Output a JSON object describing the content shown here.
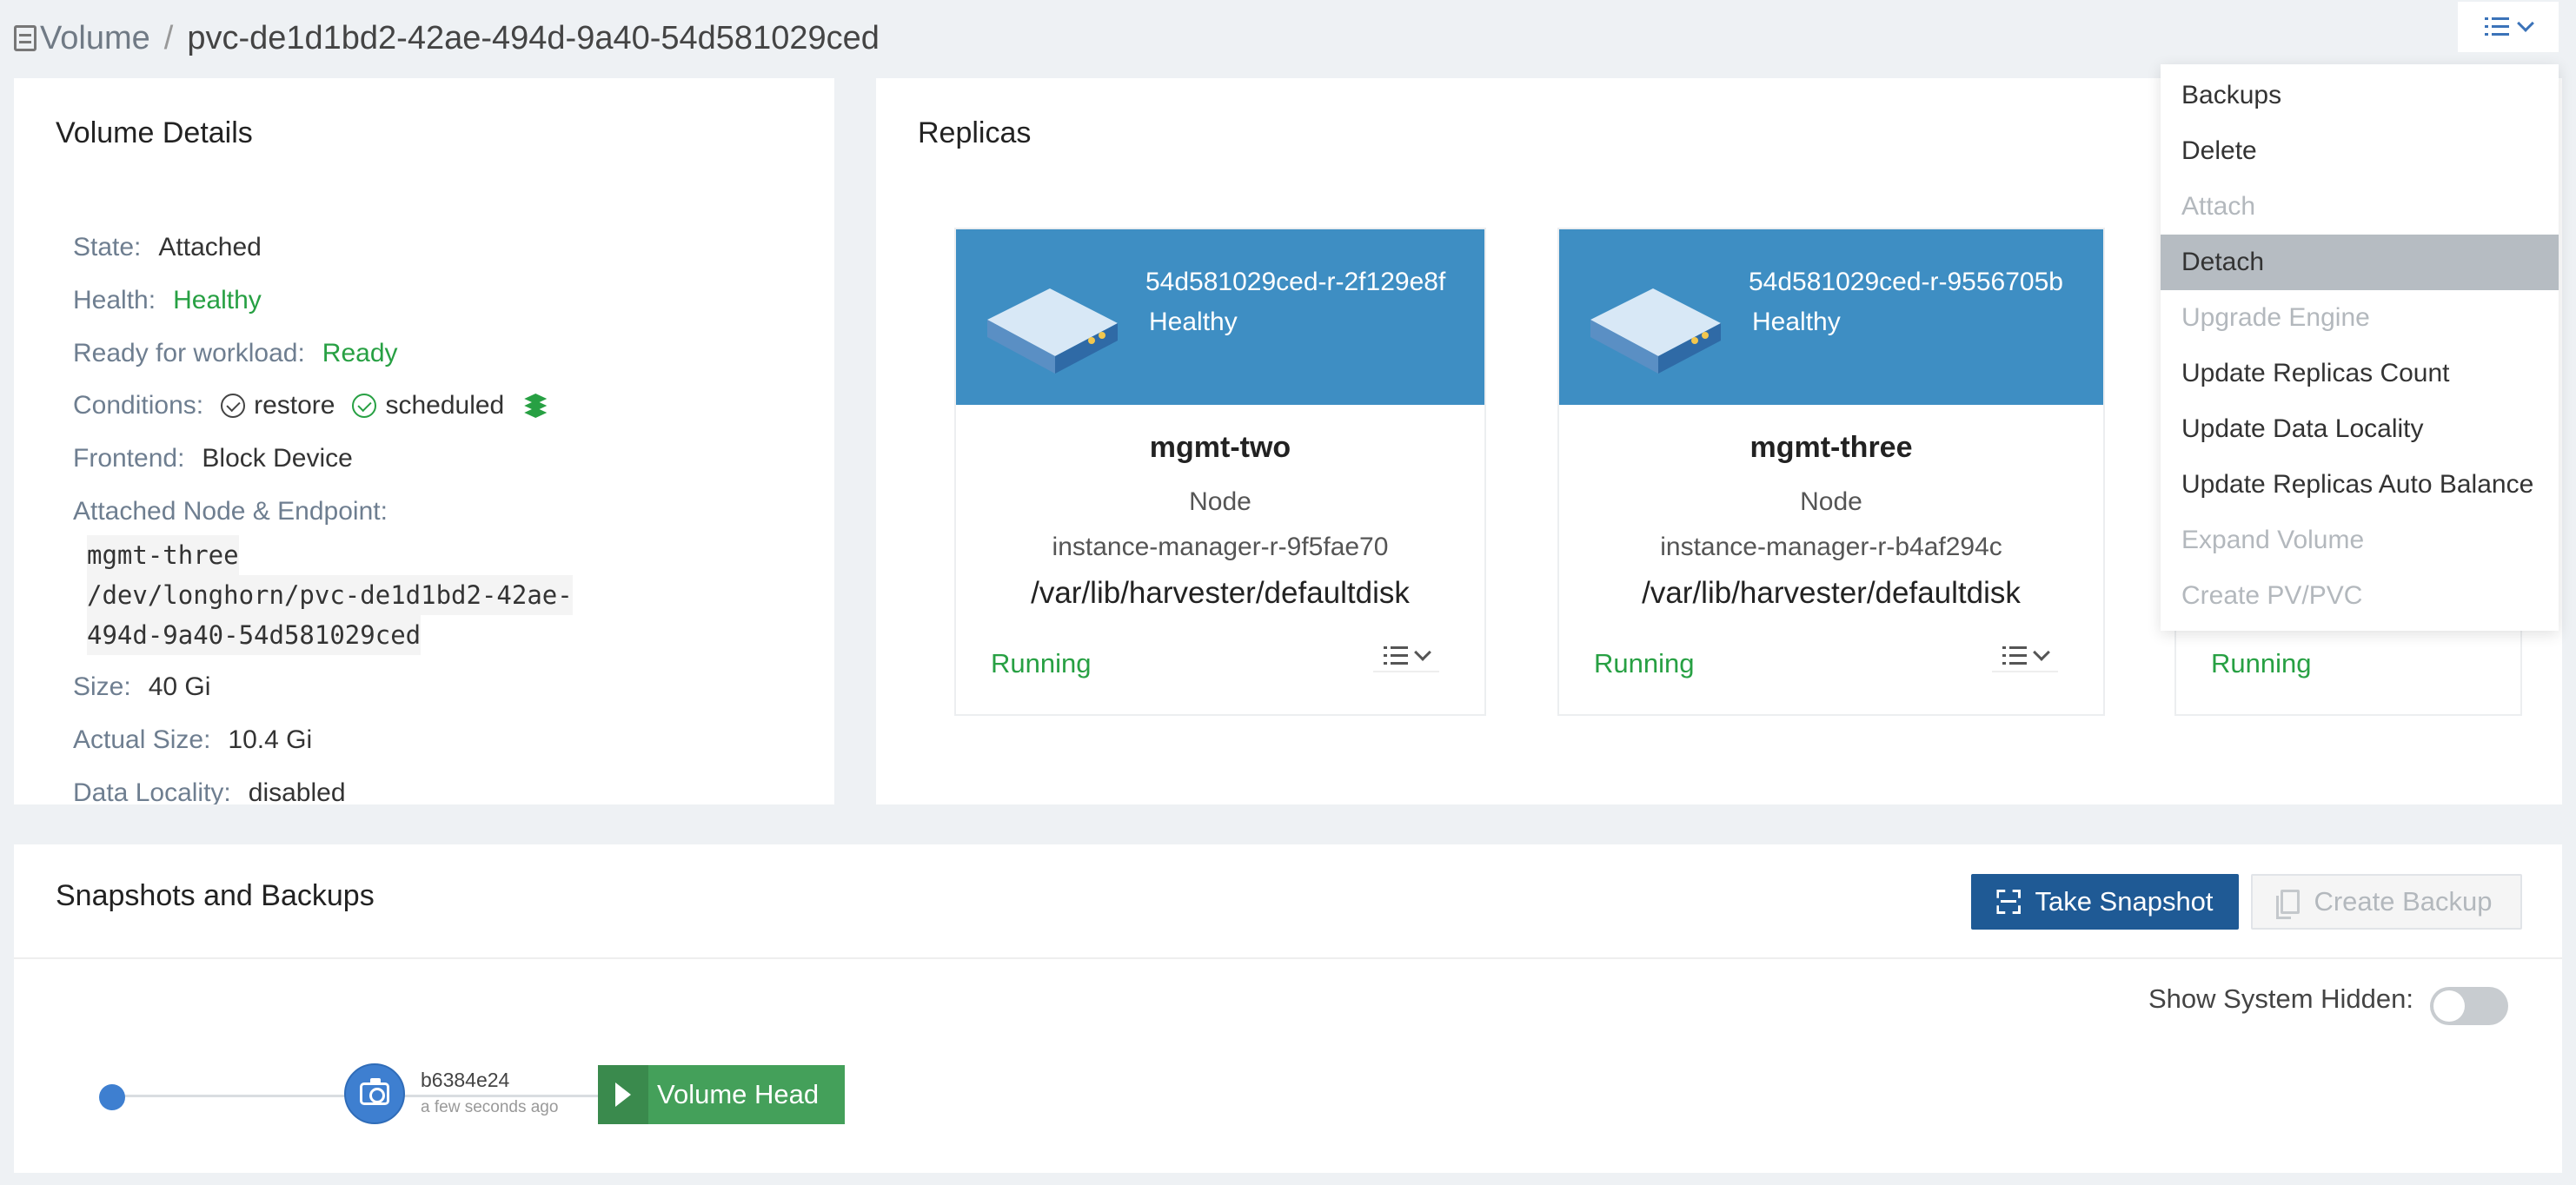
{
  "breadcrumb": {
    "root": "Volume",
    "separator": "/",
    "current": "pvc-de1d1bd2-42ae-494d-9a40-54d581029ced"
  },
  "details": {
    "title": "Volume Details",
    "state_label": "State:",
    "state_value": "Attached",
    "health_label": "Health:",
    "health_value": "Healthy",
    "ready_label": "Ready for workload:",
    "ready_value": "Ready",
    "conditions_label": "Conditions:",
    "condition_1": "restore",
    "condition_2": "scheduled",
    "frontend_label": "Frontend:",
    "frontend_value": "Block Device",
    "endpoint_label": "Attached Node & Endpoint:",
    "endpoint_line_1": "mgmt-three",
    "endpoint_line_2": "/dev/longhorn/pvc-de1d1bd2-42ae-",
    "endpoint_line_3": "494d-9a40-54d581029ced",
    "size_label": "Size:",
    "size_value": "40 Gi",
    "actual_size_label": "Actual Size:",
    "actual_size_value": "10.4 Gi",
    "locality_label": "Data Locality:",
    "locality_value": "disabled"
  },
  "replicas": {
    "title": "Replicas",
    "items": [
      {
        "name": "54d581029ced-r-2f129e8f",
        "health": "Healthy",
        "node": "mgmt-two",
        "node_label": "Node",
        "instance": "instance-manager-r-9f5fae70",
        "path": "/var/lib/harvester/defaultdisk",
        "status": "Running"
      },
      {
        "name": "54d581029ced-r-9556705b",
        "health": "Healthy",
        "node": "mgmt-three",
        "node_label": "Node",
        "instance": "instance-manager-r-b4af294c",
        "path": "/var/lib/harvester/defaultdisk",
        "status": "Running"
      },
      {
        "status": "Running"
      }
    ]
  },
  "dropdown": {
    "items": [
      {
        "label": "Backups"
      },
      {
        "label": "Delete"
      },
      {
        "label": "Attach"
      },
      {
        "label": "Detach"
      },
      {
        "label": "Upgrade Engine"
      },
      {
        "label": "Update Replicas Count"
      },
      {
        "label": "Update Data Locality"
      },
      {
        "label": "Update Replicas Auto Balance"
      },
      {
        "label": "Expand Volume"
      },
      {
        "label": "Create PV/PVC"
      }
    ]
  },
  "snapshots": {
    "title": "Snapshots and Backups",
    "take_snapshot": "Take Snapshot",
    "create_backup": "Create Backup",
    "show_hidden_label": "Show System Hidden:",
    "snapshot_id": "b6384e24",
    "snapshot_time": "a few seconds ago",
    "volume_head": "Volume Head"
  },
  "colors": {
    "accent": "#3e8ec3",
    "primary_button": "#1f5a95",
    "success": "#27a043",
    "volume_head": "#44a05a"
  }
}
